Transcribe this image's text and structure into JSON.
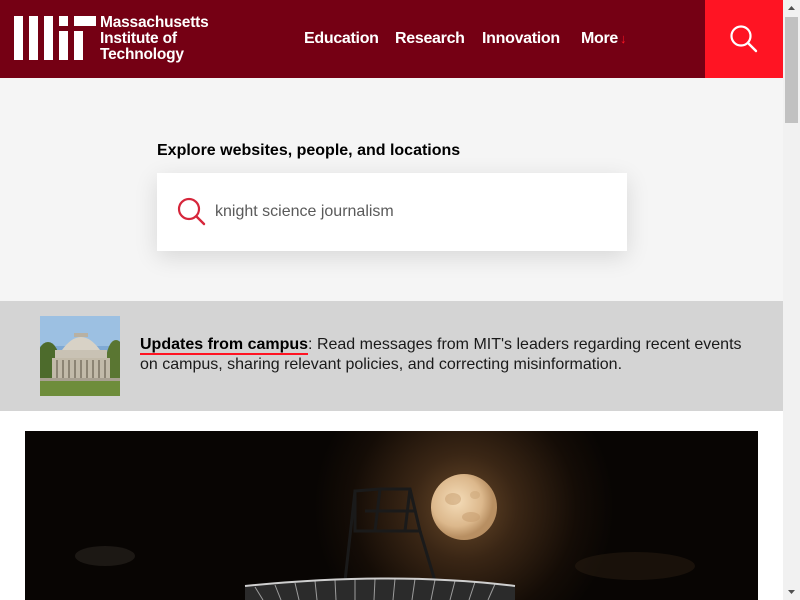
{
  "header": {
    "logo_lines": [
      "Massachusetts",
      "Institute of",
      "Technology"
    ],
    "background_color": "#750014",
    "nav": [
      {
        "label": "Education"
      },
      {
        "label": "Research"
      },
      {
        "label": "Innovation"
      },
      {
        "label": "More",
        "icon": "arrow-down-icon"
      }
    ],
    "search_icon": "search-icon"
  },
  "search": {
    "label": "Explore websites, people, and locations",
    "value": "knight science journalism",
    "icon": "search-icon"
  },
  "updates": {
    "link_label": "Updates from campus",
    "message": ": Read messages from MIT's leaders regarding recent events on campus, sharing relevant policies, and correcting misinformation."
  },
  "colors": {
    "mit_red": "#750014",
    "bright_red": "#ff1423",
    "banner_gray": "#d4d4d4",
    "page_bg": "#f5f5f5"
  }
}
